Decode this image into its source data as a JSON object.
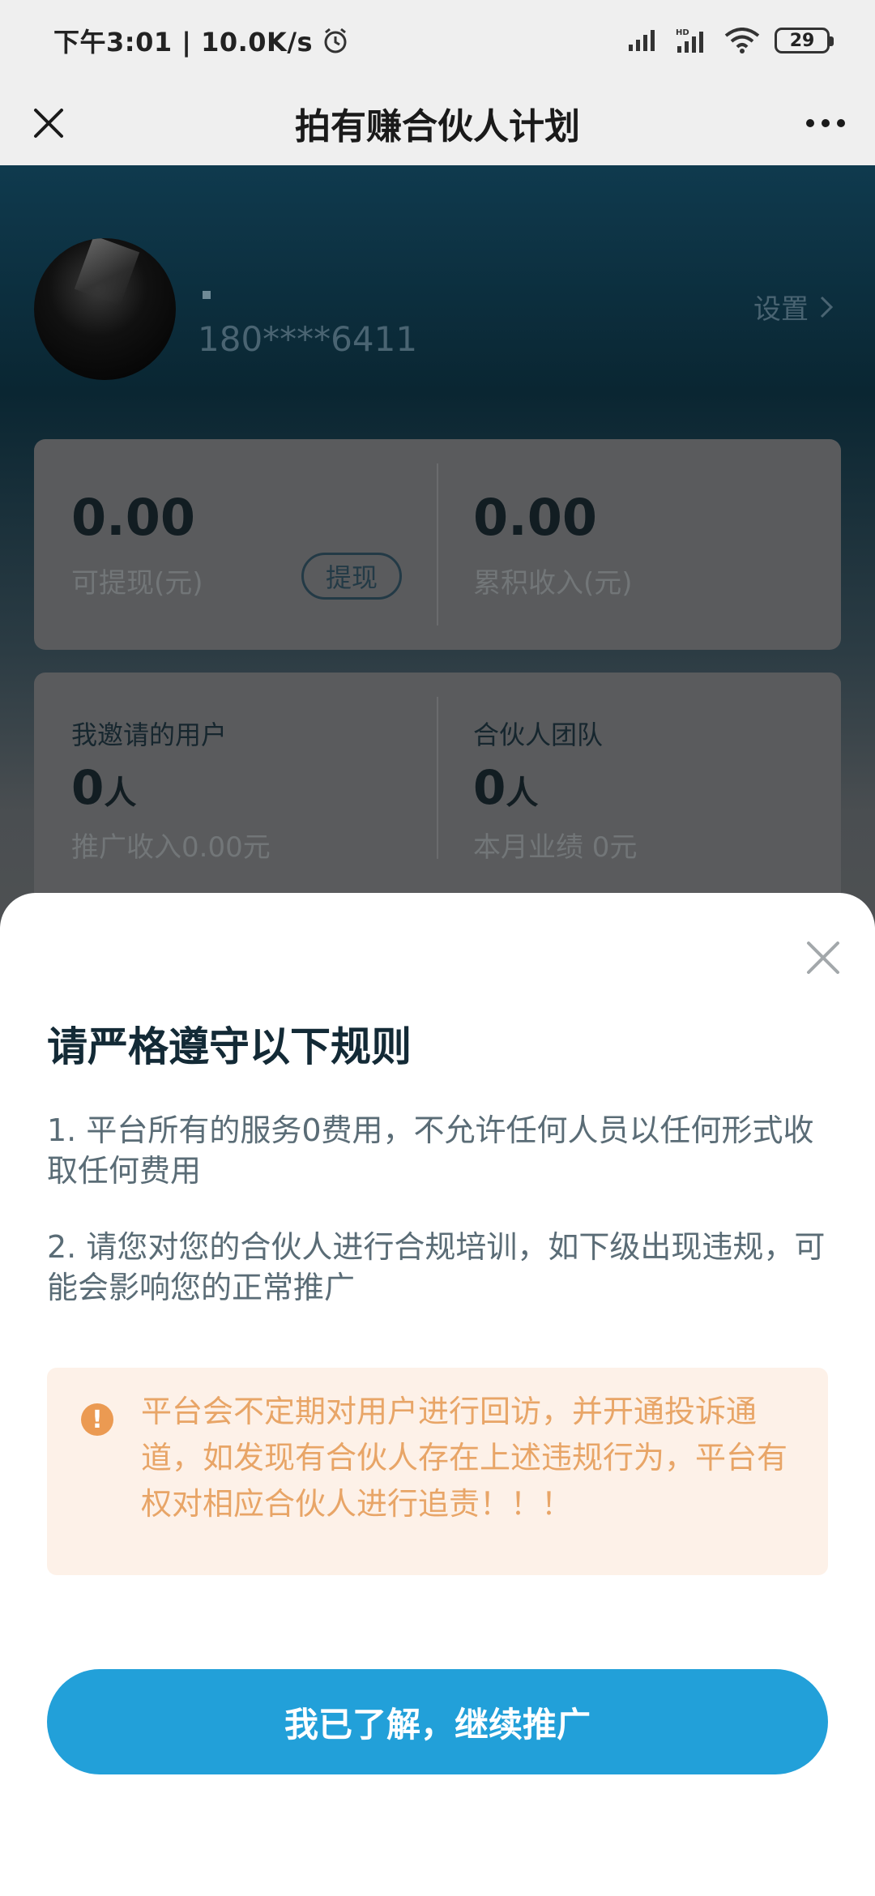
{
  "status_bar": {
    "time_speed": "下午3:01 | 10.0K/s",
    "battery": "29",
    "icons": [
      "alarm-icon",
      "signal-icon",
      "hd-signal-icon",
      "wifi-icon",
      "battery-icon"
    ]
  },
  "nav": {
    "title": "拍有赚合伙人计划",
    "close_icon": "close-icon",
    "more_icon": "more-icon"
  },
  "profile": {
    "name": "▪",
    "phone": "180****6411",
    "settings_label": "设置"
  },
  "earnings": {
    "withdrawable_amount": "0.00",
    "withdrawable_label": "可提现(元)",
    "withdraw_button": "提现",
    "total_amount": "0.00",
    "total_label": "累积收入(元)"
  },
  "team": {
    "invited_label": "我邀请的用户",
    "invited_count": "0",
    "invited_unit": "人",
    "invited_income": "推广收入0.00元",
    "partner_label": "合伙人团队",
    "partner_count": "0",
    "partner_unit": "人",
    "partner_performance": "本月业绩 0元"
  },
  "modal": {
    "title": "请严格遵守以下规则",
    "rules": [
      "1. 平台所有的服务0费用，不允许任何人员以任何形式收取任何费用",
      "2. 请您对您的合伙人进行合规培训，如下级出现违规，可能会影响您的正常推广"
    ],
    "notice_icon": "!",
    "notice_text": "平台会不定期对用户进行回访，并开通投诉通道，如发现有合伙人存在上述违规行为，平台有权对相应合伙人进行追责！！！",
    "confirm_button": "我已了解，继续推广",
    "colors": {
      "primary": "#22a0d9",
      "notice_bg": "#fdf1e8",
      "notice_text": "#e8a567"
    }
  }
}
